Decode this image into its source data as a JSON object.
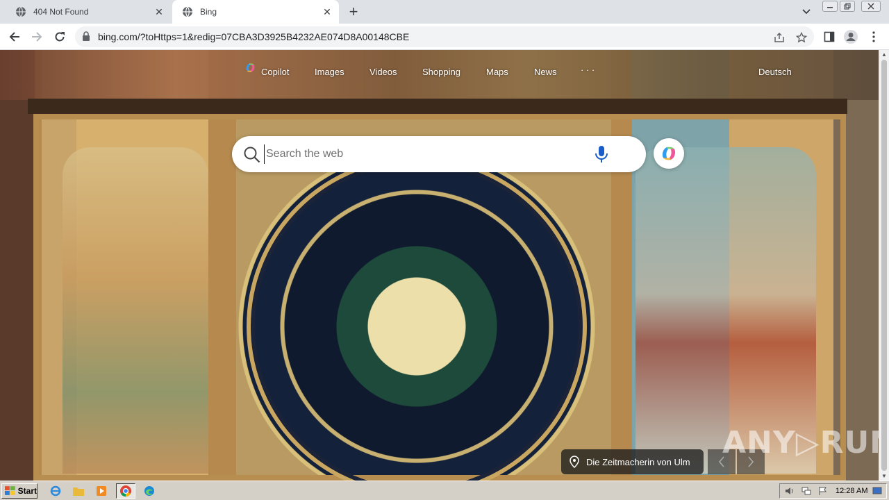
{
  "browser": {
    "tabs": [
      {
        "title": "404 Not Found",
        "active": false
      },
      {
        "title": "Bing",
        "active": true
      }
    ],
    "url": "bing.com/?toHttps=1&redig=07CBA3D3925B4232AE074D8A00148CBE"
  },
  "bing": {
    "nav": {
      "copilot": "Copilot",
      "images": "Images",
      "videos": "Videos",
      "shopping": "Shopping",
      "maps": "Maps",
      "news": "News",
      "more": "· · ·",
      "language": "Deutsch"
    },
    "search": {
      "placeholder": "Search the web",
      "value": ""
    },
    "image_info": {
      "title": "Die Zeitmacherin von Ulm"
    }
  },
  "watermark": "ANY▷RUN",
  "taskbar": {
    "start": "Start",
    "clock": "12:28 AM"
  },
  "colors": {
    "tabstrip": "#dee1e6",
    "omnibox": "#f1f3f4",
    "taskbar": "#d4d0c8"
  }
}
